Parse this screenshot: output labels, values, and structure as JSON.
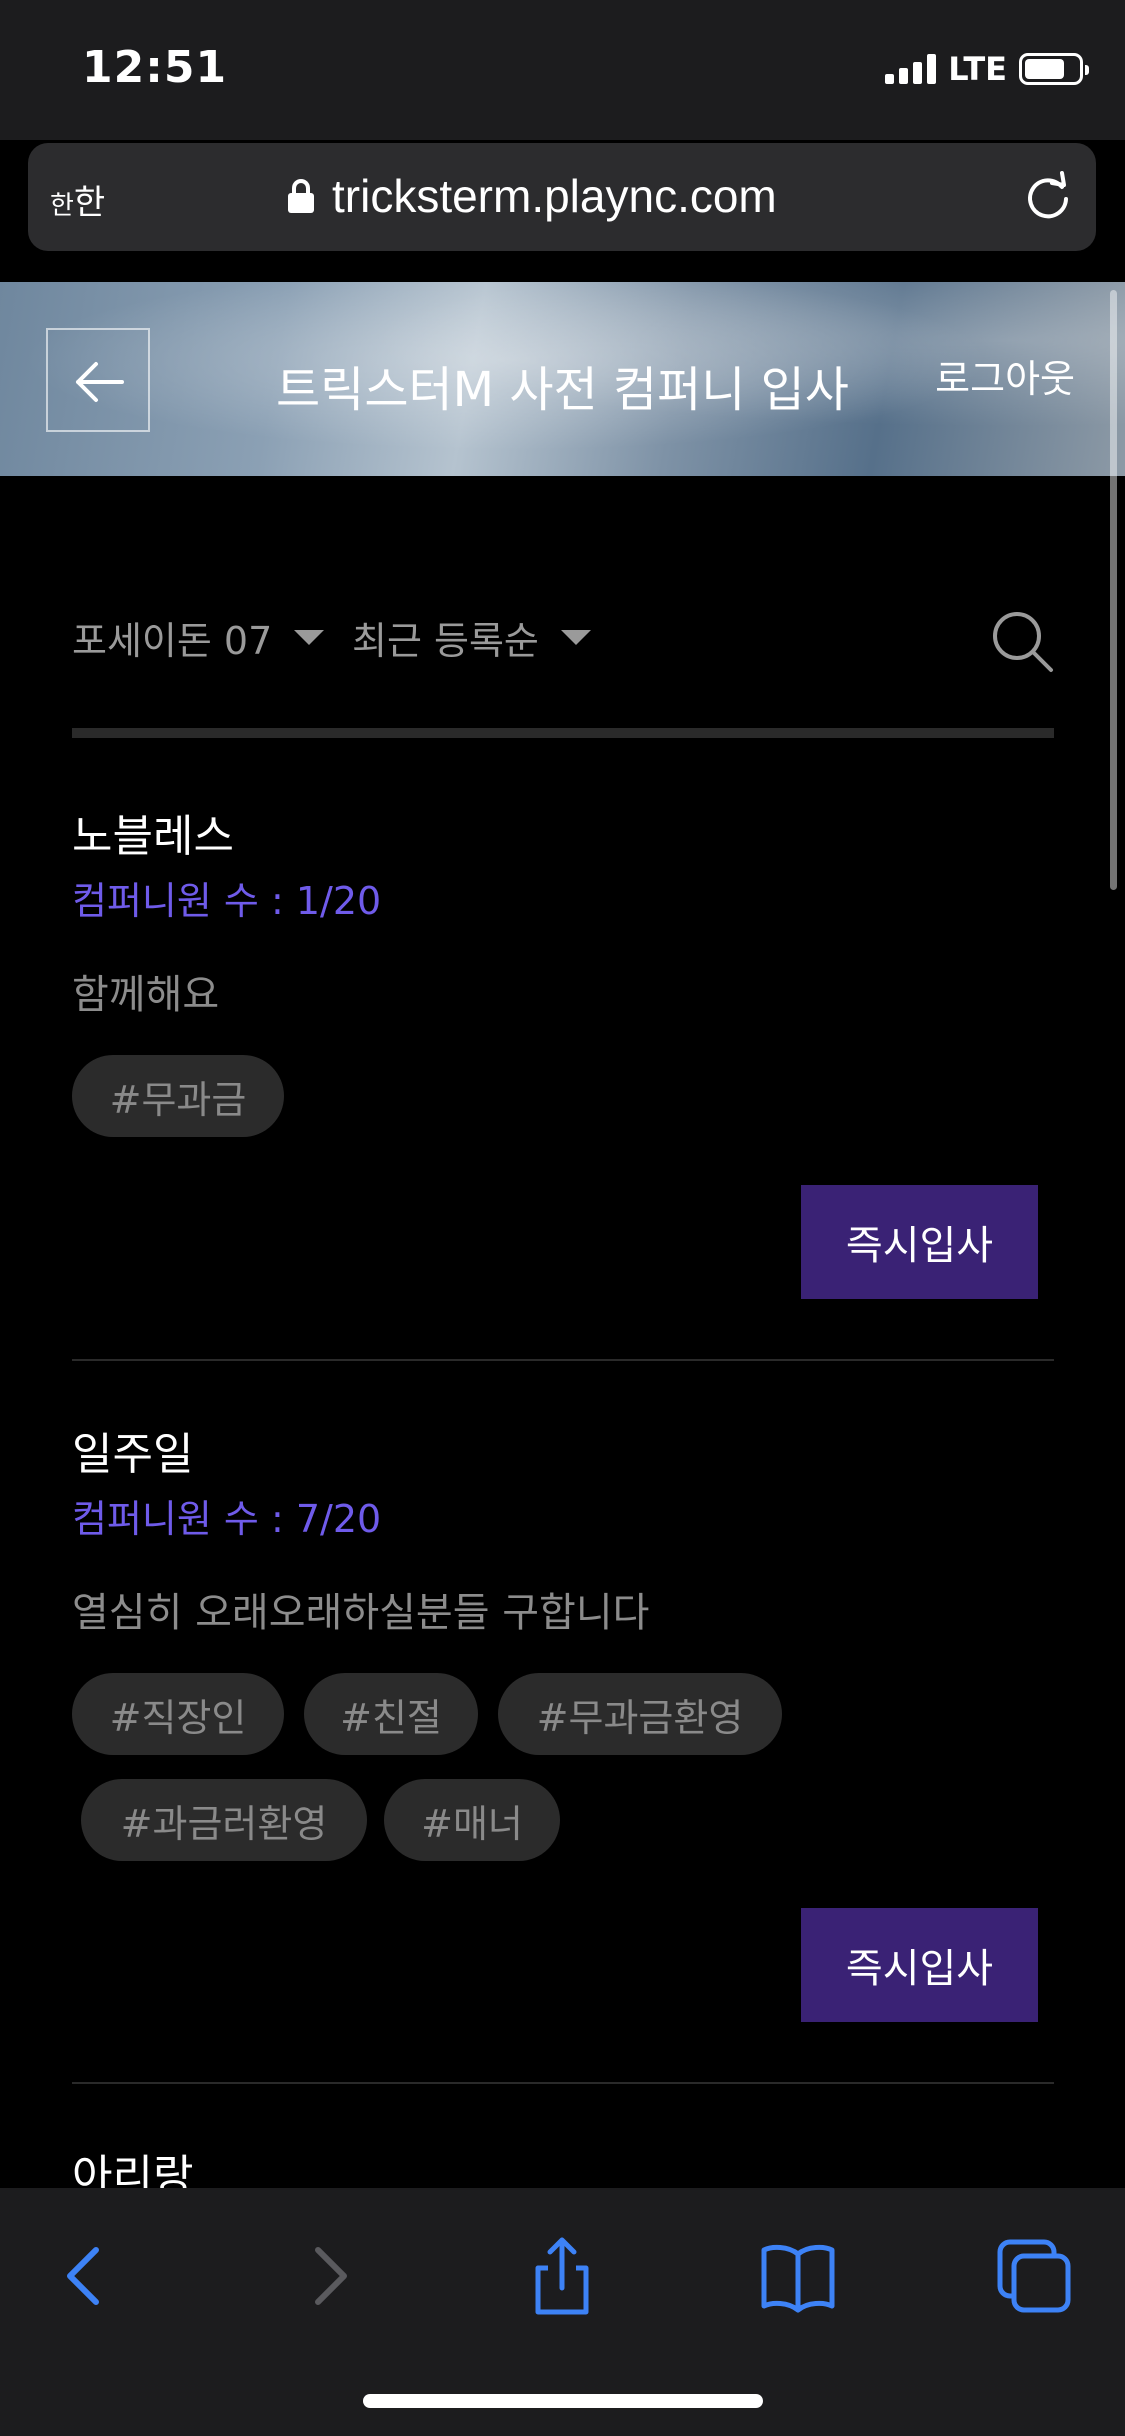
{
  "status_bar": {
    "time": "12:51",
    "network": "LTE"
  },
  "browser": {
    "text_size_label_small": "한",
    "text_size_label": "한",
    "url": "tricksterm.plaync.com"
  },
  "header": {
    "title": "트릭스터M 사전 컴퍼니 입사",
    "logout_label": "로그아웃"
  },
  "filters": {
    "server": "포세이돈 07",
    "sort": "최근 등록순"
  },
  "companies": [
    {
      "name": "노블레스",
      "members": "컴퍼니원 수 : 1/20",
      "description": "함께해요",
      "tags": [
        "#무과금"
      ],
      "join_label": "즉시입사"
    },
    {
      "name": "일주일",
      "members": "컴퍼니원 수 : 7/20",
      "description": "열심히 오래오래하실분들 구합니다",
      "tags": [
        "#직장인",
        "#친절",
        "#무과금환영",
        "#과금러환영",
        "#매너"
      ],
      "join_label": "즉시입사"
    },
    {
      "name": "아리랑"
    }
  ],
  "toolbar_icons": [
    "back-icon",
    "forward-icon",
    "share-icon",
    "bookmarks-icon",
    "tabs-icon"
  ],
  "colors": {
    "accent": "#6f5bea",
    "button": "#3a2275",
    "safari_blue": "#3d82f6"
  }
}
